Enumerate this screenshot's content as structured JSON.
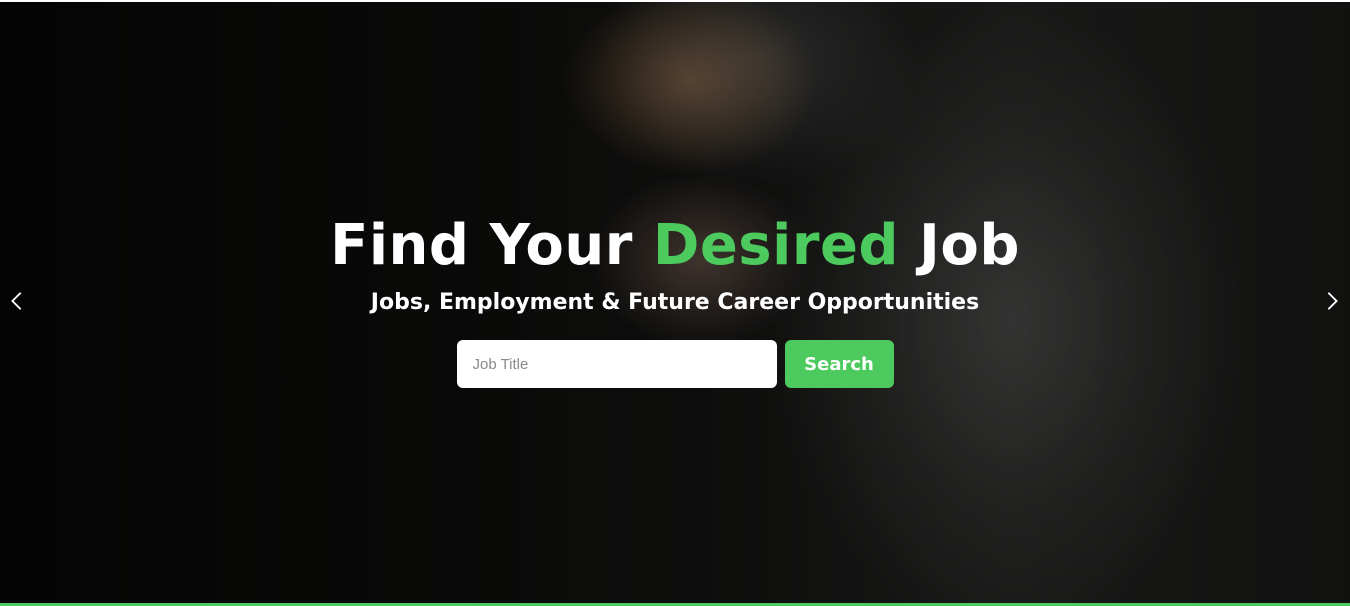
{
  "hero": {
    "headline": {
      "part1": "Find Your ",
      "accent": "Desired",
      "part2": " Job"
    },
    "subheadline": "Jobs, Employment & Future Career Opportunities",
    "search": {
      "placeholder": "Job Title",
      "value": "",
      "button_label": "Search"
    },
    "carousel": {
      "prev_icon": "chevron-left-icon",
      "next_icon": "chevron-right-icon"
    }
  },
  "colors": {
    "accent": "#4cca5d",
    "text": "#ffffff",
    "overlay": "#0a0a0a"
  }
}
